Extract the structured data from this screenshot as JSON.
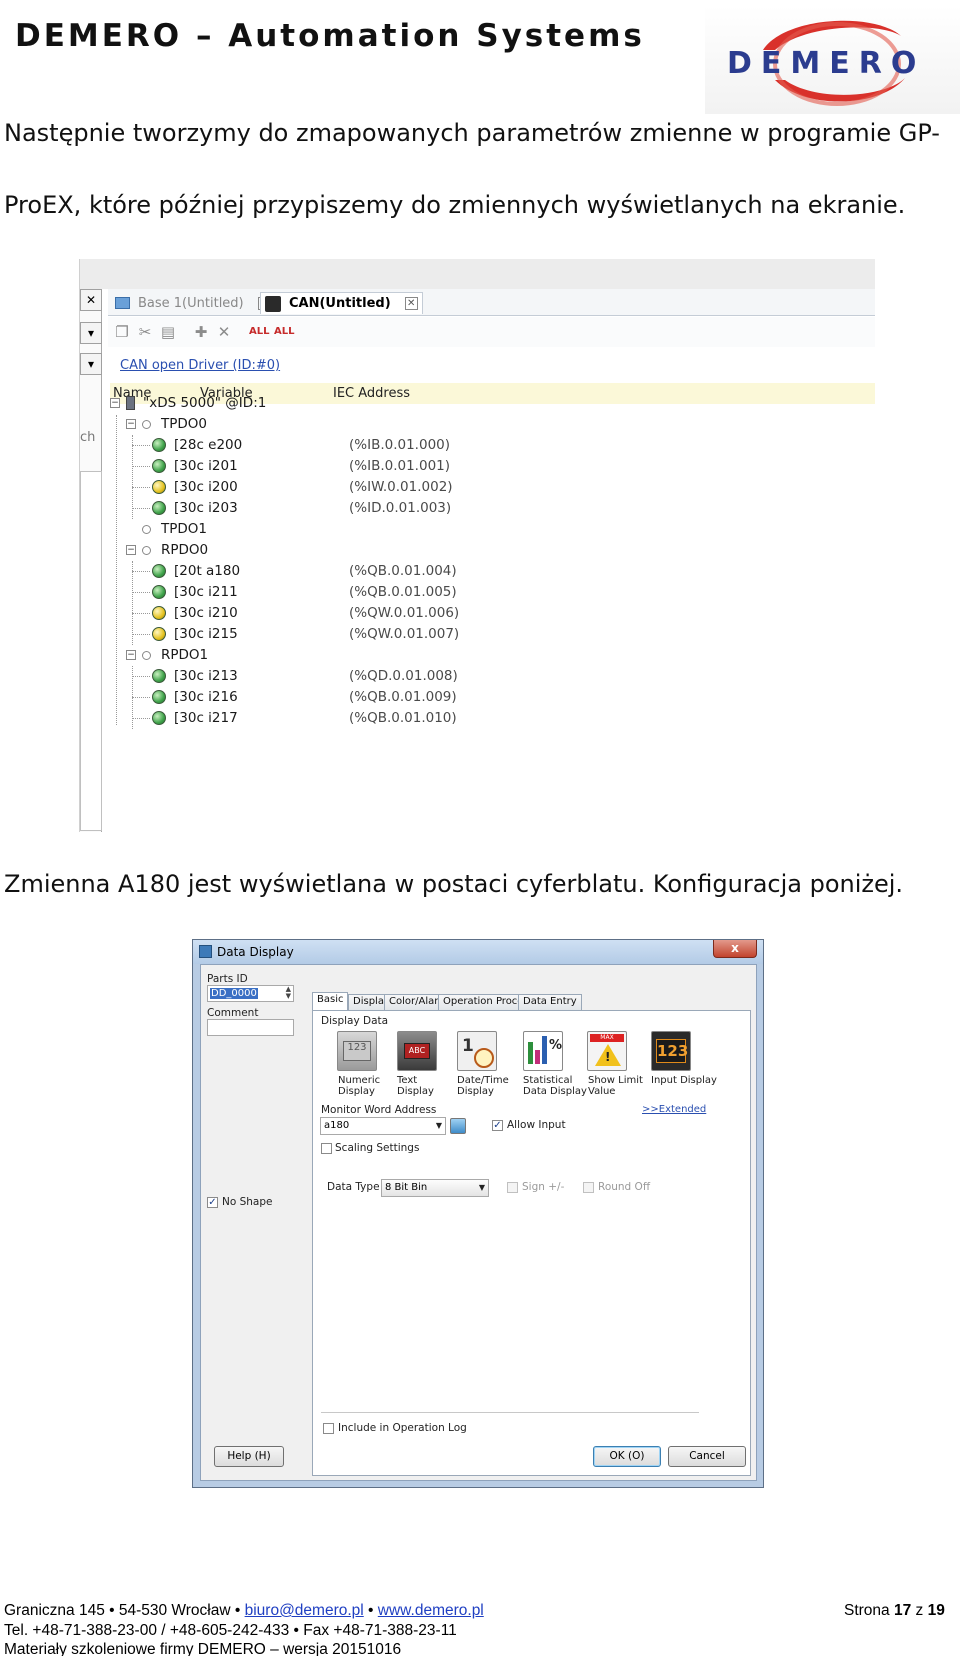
{
  "header": {
    "title": "DEMERO – Automation Systems",
    "logo_text": "DEMERO"
  },
  "paragraphs": {
    "p1_line1": "Następnie tworzymy do zmapowanych parametrów zmienne w programie GP-",
    "p1_line2": "ProEX, które później przypiszemy do zmiennych wyświetlanych na ekranie.",
    "p2": "Zmienna A180 jest wyświetlana w postaci cyferblatu. Konfiguracja poniżej."
  },
  "editor": {
    "left_pane_text": "ch",
    "tabs": [
      {
        "label": "Base 1(Untitled)",
        "active": false
      },
      {
        "label": "CAN(Untitled)",
        "active": true
      }
    ],
    "toolbar_all_labels": [
      "ALL",
      "ALL"
    ],
    "driver_link": "CAN open Driver (ID:#0)",
    "columns": {
      "name": "Name",
      "variable": "Variable",
      "iec": "IEC Address"
    },
    "device": "\"xDS 5000\" @ID:1",
    "groups": [
      {
        "name": "TPDO0",
        "expanded": true,
        "items": [
          {
            "name": "[28c e200",
            "iec": "(%IB.0.01.000)",
            "color": "green"
          },
          {
            "name": "[30c i201",
            "iec": "(%IB.0.01.001)",
            "color": "green"
          },
          {
            "name": "[30c i200",
            "iec": "(%IW.0.01.002)",
            "color": "yellow"
          },
          {
            "name": "[30c i203",
            "iec": "(%ID.0.01.003)",
            "color": "green"
          }
        ]
      },
      {
        "name": "TPDO1",
        "expanded": false,
        "items": []
      },
      {
        "name": "RPDO0",
        "expanded": true,
        "items": [
          {
            "name": "[20t a180",
            "iec": "(%QB.0.01.004)",
            "color": "green"
          },
          {
            "name": "[30c i211",
            "iec": "(%QB.0.01.005)",
            "color": "green"
          },
          {
            "name": "[30c i210",
            "iec": "(%QW.0.01.006)",
            "color": "yellow"
          },
          {
            "name": "[30c i215",
            "iec": "(%QW.0.01.007)",
            "color": "yellow"
          }
        ]
      },
      {
        "name": "RPDO1",
        "expanded": true,
        "items": [
          {
            "name": "[30c i213",
            "iec": "(%QD.0.01.008)",
            "color": "green"
          },
          {
            "name": "[30c i216",
            "iec": "(%QB.0.01.009)",
            "color": "green"
          },
          {
            "name": "[30c i217",
            "iec": "(%QB.0.01.010)",
            "color": "green"
          }
        ]
      }
    ]
  },
  "dialog": {
    "title": "Data Display",
    "close_label": "x",
    "parts_id_label": "Parts ID",
    "parts_id_value": "DD_0000",
    "comment_label": "Comment",
    "comment_value": "",
    "no_shape_label": "No Shape",
    "no_shape_checked": true,
    "tabs": [
      "Basic",
      "Display",
      "Color/Alarm",
      "Operation Process",
      "Data Entry"
    ],
    "display_data_label": "Display Data",
    "display_types": [
      {
        "label": "Numeric\nDisplay",
        "icon": "numeric-display-icon"
      },
      {
        "label": "Text\nDisplay",
        "icon": "text-display-icon"
      },
      {
        "label": "Date/Time\nDisplay",
        "icon": "datetime-display-icon"
      },
      {
        "label": "Statistical\nData Display",
        "icon": "statistical-display-icon"
      },
      {
        "label": "Show Limit\nValue",
        "icon": "show-limit-icon"
      },
      {
        "label": "Input Display",
        "icon": "input-display-icon"
      }
    ],
    "monitor_label": "Monitor Word Address",
    "extended_link": ">>Extended",
    "monitor_value": "a180",
    "allow_input_label": "Allow Input",
    "allow_input_checked": true,
    "scaling_label": "Scaling Settings",
    "data_type_label": "Data Type",
    "data_type_value": "8 Bit Bin",
    "sign_label": "Sign +/-",
    "round_off_label": "Round Off",
    "include_log_label": "Include in Operation Log",
    "help_button": "Help (H)",
    "ok_button": "OK (O)",
    "cancel_button": "Cancel"
  },
  "footer": {
    "address": "Graniczna 145 • 54-530 Wrocław • ",
    "email": "biuro@demero.pl",
    "bullet": " • ",
    "website": "www.demero.pl",
    "page_prefix": "Strona ",
    "page_current": "17",
    "page_sep": " z ",
    "page_total": "19",
    "phone_line": "Tel. +48-71-388-23-00 / +48-605-242-433 • Fax +48-71-388-23-11",
    "materials_line": "Materiały szkoleniowe firmy DEMERO – wersja 20151016"
  },
  "colors": {
    "logo_red": "#d9312b",
    "logo_blue": "#2b3c8f",
    "link_blue": "#1f3fc2",
    "tag_green": "#3fa34a",
    "tag_yellow": "#e4c21f",
    "header_band": "#fbf8d8"
  }
}
